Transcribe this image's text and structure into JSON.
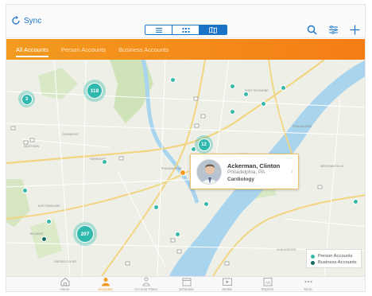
{
  "topbar": {
    "sync_label": "Sync",
    "views": [
      "list-view",
      "grid-view",
      "map-view"
    ],
    "active_view": "map-view"
  },
  "tabs": [
    {
      "label": "All Accounts",
      "active": true
    },
    {
      "label": "Person Accounts",
      "active": false
    },
    {
      "label": "Business Accounts",
      "active": false
    }
  ],
  "clusters": [
    {
      "count": "3"
    },
    {
      "count": "118"
    },
    {
      "count": "12"
    },
    {
      "count": "207"
    }
  ],
  "popup": {
    "name": "Ackerman, Clinton",
    "location": "Philadelphia, PA",
    "specialty": "Cardiology"
  },
  "legend": {
    "person": "Person Accounts",
    "business": "Business Accounts"
  },
  "colors": {
    "accent": "#f39a1f",
    "blue": "#1a73c8",
    "person": "#35b9a9",
    "business": "#136b63"
  },
  "nav": [
    {
      "label": "Home",
      "icon": "home-icon",
      "active": false
    },
    {
      "label": "Accounts",
      "icon": "accounts-icon",
      "active": true
    },
    {
      "label": "Account Plans",
      "icon": "account-plans-icon",
      "active": false
    },
    {
      "label": "Schedule",
      "icon": "calendar-icon",
      "active": false
    },
    {
      "label": "Media",
      "icon": "media-icon",
      "active": false
    },
    {
      "label": "Reports",
      "icon": "reports-icon",
      "active": false
    },
    {
      "label": "More",
      "icon": "more-icon",
      "active": false
    }
  ]
}
